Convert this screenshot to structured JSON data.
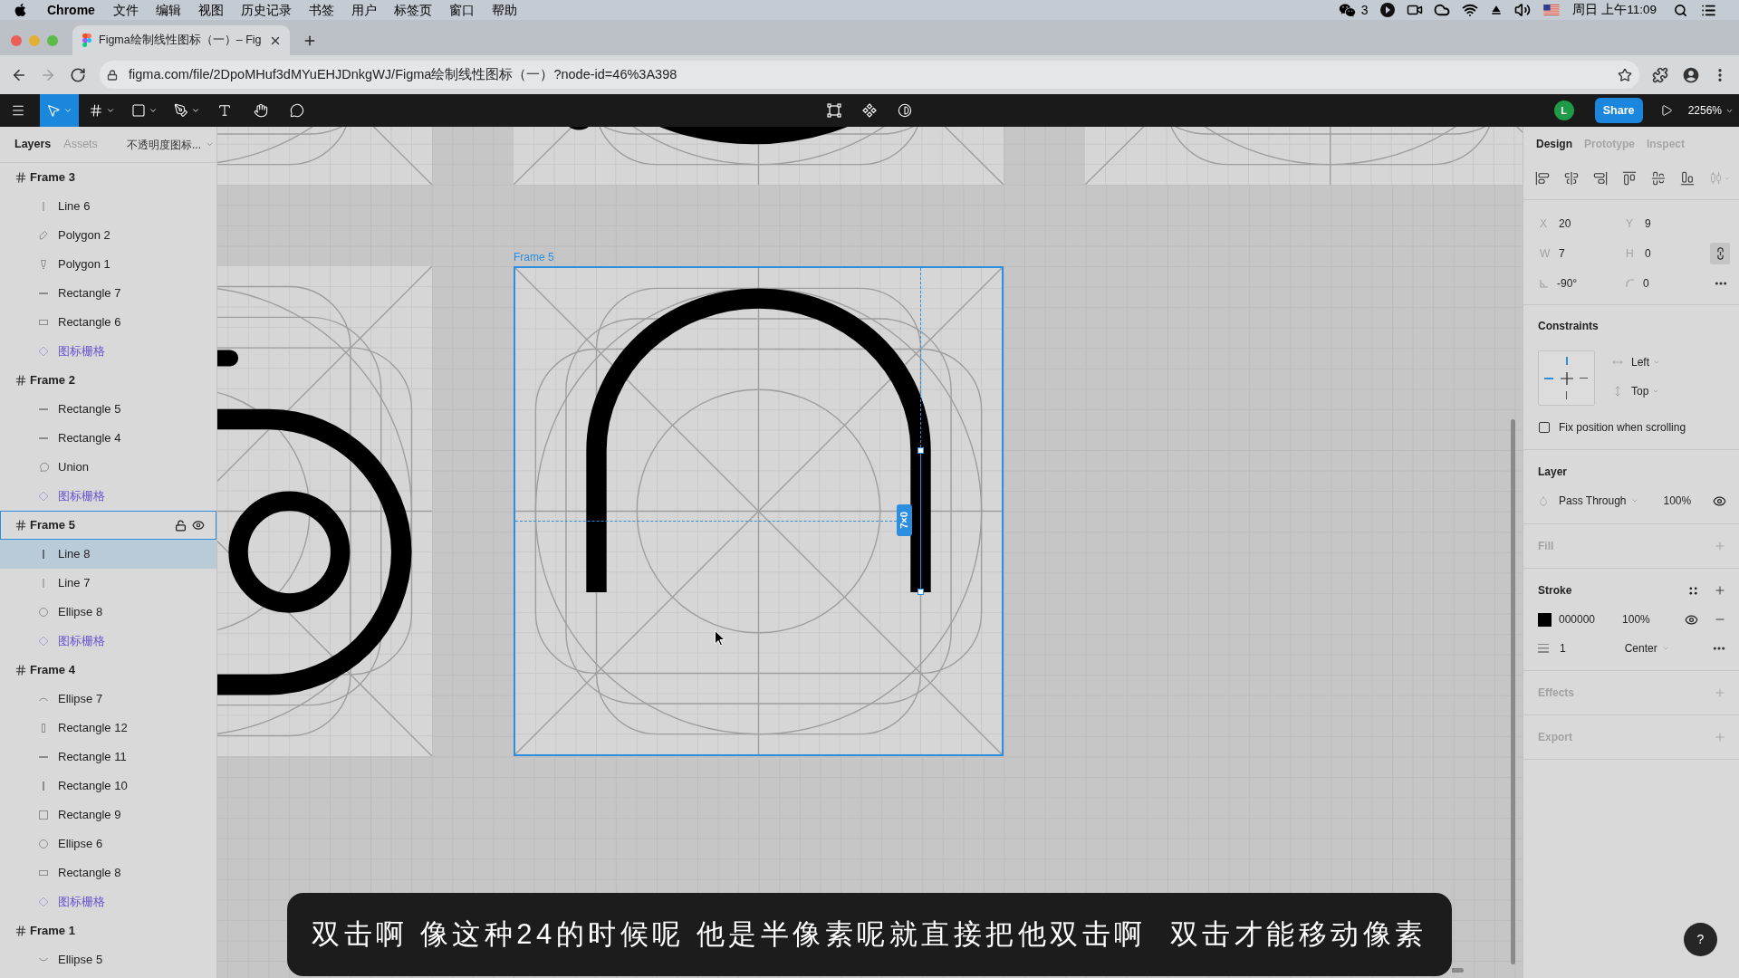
{
  "menu_bar": {
    "app": "Chrome",
    "menus": [
      "文件",
      "编辑",
      "视图",
      "历史记录",
      "书签",
      "用户",
      "标签页",
      "窗口",
      "帮助"
    ],
    "wechat_count": "3",
    "clock": "周日 上午11:09"
  },
  "browser": {
    "tab_title": "Figma绘制线性图标（一）– Fig",
    "nav": [
      {
        "kind": "back",
        "disabled": false
      },
      {
        "kind": "forward",
        "disabled": true
      },
      {
        "kind": "reload",
        "disabled": false
      }
    ],
    "url": "figma.com/file/2DpoMHuf3dMYuEHJDnkgWJ/Figma绘制线性图标（一）?node-id=46%3A398"
  },
  "toolbar": {
    "tools": [
      {
        "kind": "move",
        "selected": true,
        "caret": true
      },
      {
        "kind": "frame",
        "selected": false,
        "caret": true
      },
      {
        "kind": "rectangle",
        "selected": false,
        "caret": true
      },
      {
        "kind": "pen",
        "selected": false,
        "caret": true
      },
      {
        "kind": "text",
        "selected": false,
        "caret": false
      },
      {
        "kind": "hand",
        "selected": false,
        "caret": false
      },
      {
        "kind": "comment",
        "selected": false,
        "caret": false
      }
    ],
    "actions": [
      {
        "kind": "edit"
      },
      {
        "kind": "component"
      },
      {
        "kind": "mask"
      }
    ],
    "avatar": "L",
    "share": "Share",
    "zoom": "2256%"
  },
  "layers_panel": {
    "tabs": [
      {
        "label": "Layers",
        "selected": true
      },
      {
        "label": "Assets",
        "selected": false
      }
    ],
    "page": "不透明度图标...",
    "layers": [
      {
        "name": "Frame 3",
        "kind": "frame",
        "selected": false,
        "hovered": false,
        "children": [
          {
            "name": "Line 6",
            "kind": "line",
            "selected": false
          },
          {
            "name": "Polygon 2",
            "kind": "polygon-tilted",
            "selected": false
          },
          {
            "name": "Polygon 1",
            "kind": "polygon",
            "selected": false
          },
          {
            "name": "Rectangle 7",
            "kind": "rect-flat",
            "selected": false
          },
          {
            "name": "Rectangle 6",
            "kind": "rect-wide",
            "selected": false
          },
          {
            "name": "图标栅格",
            "kind": "instance",
            "selected": false
          }
        ]
      },
      {
        "name": "Frame 2",
        "kind": "frame",
        "selected": false,
        "hovered": false,
        "children": [
          {
            "name": "Rectangle 5",
            "kind": "rect-flat",
            "selected": false
          },
          {
            "name": "Rectangle 4",
            "kind": "rect-flat",
            "selected": false
          },
          {
            "name": "Union",
            "kind": "union",
            "selected": false
          },
          {
            "name": "图标栅格",
            "kind": "instance",
            "selected": false
          }
        ]
      },
      {
        "name": "Frame 5",
        "kind": "frame",
        "selected": false,
        "hovered": true,
        "children": [
          {
            "name": "Line 8",
            "kind": "line",
            "selected": true
          },
          {
            "name": "Line 7",
            "kind": "line",
            "selected": false
          },
          {
            "name": "Ellipse 8",
            "kind": "ellipse",
            "selected": false
          },
          {
            "name": "图标栅格",
            "kind": "instance",
            "selected": false
          }
        ]
      },
      {
        "name": "Frame 4",
        "kind": "frame",
        "selected": false,
        "hovered": false,
        "children": [
          {
            "name": "Ellipse 7",
            "kind": "arc-top",
            "selected": false
          },
          {
            "name": "Rectangle 12",
            "kind": "rect-tall",
            "selected": false
          },
          {
            "name": "Rectangle 11",
            "kind": "rect-flat",
            "selected": false
          },
          {
            "name": "Rectangle 10",
            "kind": "rect-bar",
            "selected": false
          },
          {
            "name": "Rectangle 9",
            "kind": "rect-square",
            "selected": false
          },
          {
            "name": "Ellipse 6",
            "kind": "ellipse",
            "selected": false
          },
          {
            "name": "Rectangle 8",
            "kind": "rect-wide",
            "selected": false
          },
          {
            "name": "图标栅格",
            "kind": "instance",
            "selected": false
          }
        ]
      },
      {
        "name": "Frame 1",
        "kind": "frame",
        "selected": false,
        "hovered": false,
        "children": [
          {
            "name": "Ellipse 5",
            "kind": "arc-bottom",
            "selected": false
          }
        ]
      }
    ]
  },
  "canvas": {
    "frame_label": "Frame 5",
    "size_badge": "7×0"
  },
  "design_panel": {
    "tabs": [
      {
        "label": "Design",
        "selected": true
      },
      {
        "label": "Prototype",
        "selected": false
      },
      {
        "label": "Inspect",
        "selected": false
      }
    ],
    "fields": [
      {
        "label": "X",
        "value": "20"
      },
      {
        "label": "Y",
        "value": "9"
      },
      {
        "label": "W",
        "value": "7"
      },
      {
        "label": "H",
        "value": "0"
      }
    ],
    "rotation": "-90°",
    "radius": "0",
    "constrain_proportions": true,
    "constraints": {
      "title": "Constraints",
      "horizontal": "Left",
      "vertical": "Top",
      "pinned": {
        "left": true,
        "right": false,
        "top": true,
        "bottom": false
      },
      "fix_position": {
        "label": "Fix position when scrolling",
        "checked": false
      }
    },
    "layer": {
      "title": "Layer",
      "blend": "Pass Through",
      "opacity": "100%",
      "visible": true
    },
    "fill": {
      "title": "Fill",
      "empty": true
    },
    "stroke": {
      "title": "Stroke",
      "empty": false,
      "paints": [
        {
          "hex": "000000",
          "color": "#000000",
          "opacity": "100%",
          "visible": true
        }
      ],
      "weight": "1",
      "align": "Center"
    },
    "effects": {
      "title": "Effects",
      "empty": true
    },
    "export": {
      "title": "Export",
      "empty": true
    }
  },
  "subtitle": "双击啊 像这种24的时候呢 他是半像素呢就直接把他双击啊  双击才能移动像素",
  "help_button": "?"
}
